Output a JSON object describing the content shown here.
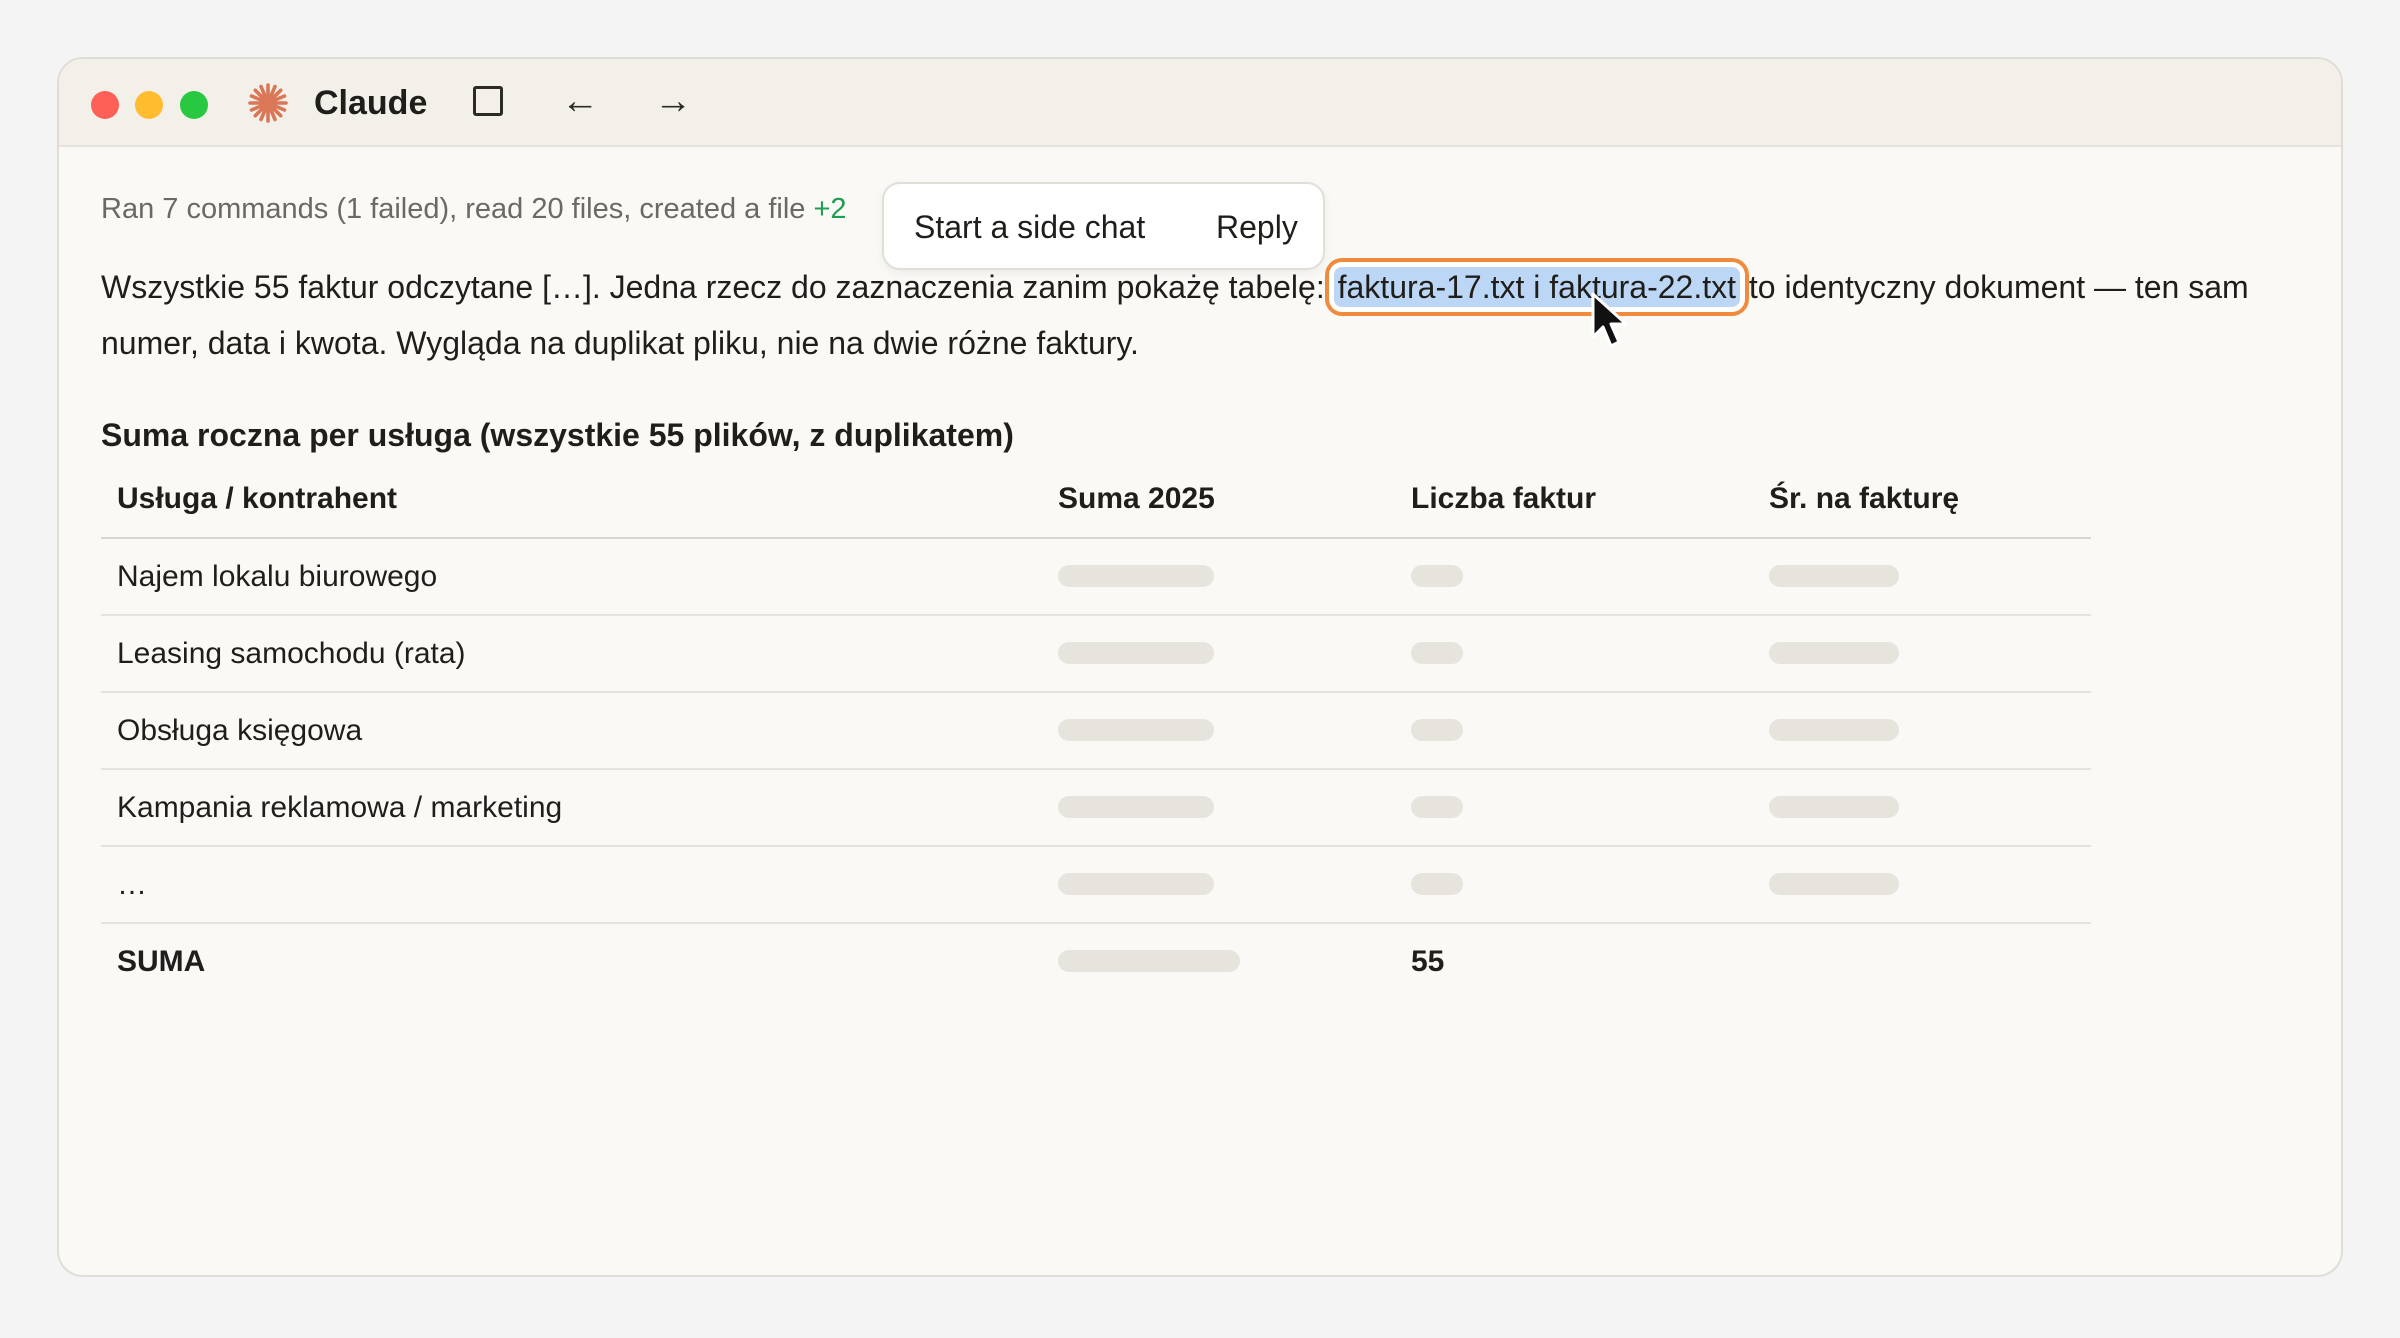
{
  "window": {
    "app_title": "Claude",
    "accent_color": "#d97757",
    "icons": [
      "claude-logo-icon",
      "sidebar-toggle-icon",
      "arrow-left-icon",
      "arrow-right-icon",
      "mouse-cursor-icon"
    ],
    "nav": {
      "back": "←",
      "forward": "→"
    }
  },
  "summary": {
    "text": "Ran 7 commands (1 failed), read 20 files, created a file",
    "added": "+2"
  },
  "popup": {
    "side_chat": "Start a side chat",
    "reply": "Reply"
  },
  "message": {
    "before": "Wszystkie 55 faktur odczytane […]. Jedna rzecz do zaznaczenia zanim pokażę tabelę: ",
    "selection": "faktura-17.txt i faktura-22.txt",
    "after": " to identyczny dokument — ten sam numer, data i kwota. Wygląda na duplikat pliku, nie na dwie różne faktury.",
    "selection_color": "#bcd7f5",
    "focus_ring_color": "#f08a3c"
  },
  "section_title": "Suma roczna per usługa (wszystkie 55 plików, z duplikatem)",
  "table": {
    "headers": [
      "Usługa / kontrahent",
      "Suma 2025",
      "Liczba faktur",
      "Śr. na fakturę"
    ],
    "rows": [
      {
        "service": "Najem lokalu biurowego"
      },
      {
        "service": "Leasing samochodu (rata)"
      },
      {
        "service": "Obsługa księgowa"
      },
      {
        "service": "Kampania reklamowa / marketing"
      },
      {
        "service": "…"
      }
    ],
    "total": {
      "label": "SUMA",
      "count": "55"
    }
  }
}
